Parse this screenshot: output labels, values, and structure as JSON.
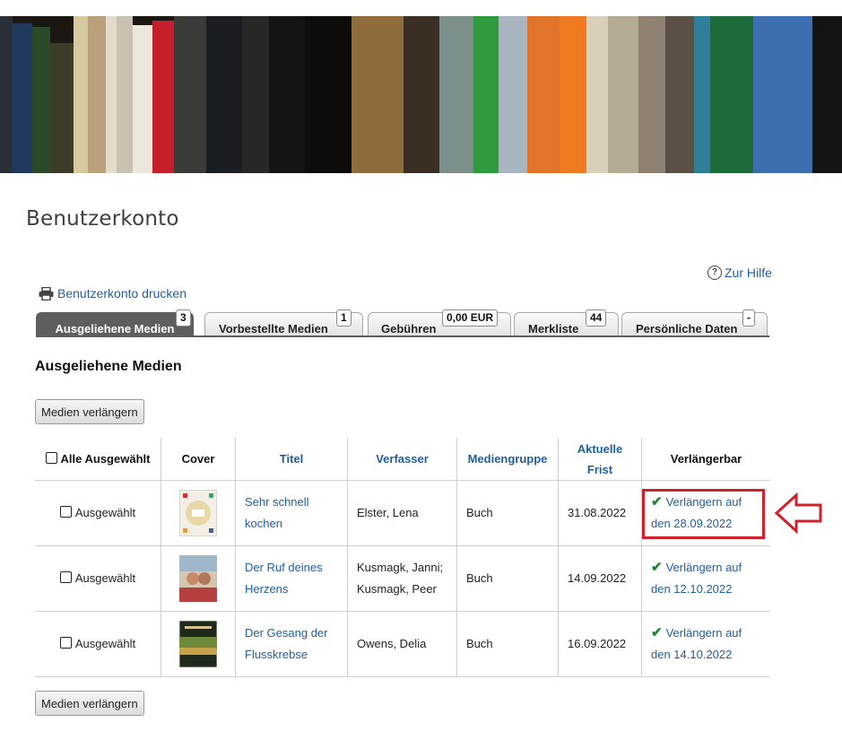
{
  "page": {
    "title": "Benutzerkonto"
  },
  "links": {
    "help": "Zur Hilfe",
    "print": "Benutzerkonto drucken"
  },
  "tabs": [
    {
      "label": "Ausgeliehene Medien",
      "badge": "3"
    },
    {
      "label": "Vorbestellte Medien",
      "badge": "1"
    },
    {
      "label": "Gebühren",
      "badge": "0,00 EUR"
    },
    {
      "label": "Merkliste",
      "badge": "44"
    },
    {
      "label": "Persönliche Daten",
      "badge": "-"
    }
  ],
  "section": {
    "title": "Ausgeliehene Medien",
    "renew_button": "Medien verlängern"
  },
  "table": {
    "headers": {
      "select_all": "Alle Ausgewählt",
      "cover": "Cover",
      "title": "Titel",
      "author": "Verfasser",
      "media_group": "Mediengruppe",
      "due_line1": "Aktuelle",
      "due_line2": "Frist",
      "renewable": "Verlängerbar"
    },
    "rows": [
      {
        "select": "Ausgewählt",
        "title_line1": "Sehr schnell",
        "title_line2": "kochen",
        "author_line1": "Elster, Lena",
        "author_line2": "",
        "media_group": "Buch",
        "due": "31.08.2022",
        "renew_line1": "Verlängern auf",
        "renew_line2": "den 28.09.2022"
      },
      {
        "select": "Ausgewählt",
        "title_line1": "Der Ruf deines",
        "title_line2": "Herzens",
        "author_line1": "Kusmagk, Janni;",
        "author_line2": "Kusmagk, Peer",
        "media_group": "Buch",
        "due": "14.09.2022",
        "renew_line1": "Verlängern auf",
        "renew_line2": "den 12.10.2022"
      },
      {
        "select": "Ausgewählt",
        "title_line1": "Der Gesang der",
        "title_line2": "Flusskrebse",
        "author_line1": "Owens, Delia",
        "author_line2": "",
        "media_group": "Buch",
        "due": "16.09.2022",
        "renew_line1": "Verlängern auf",
        "renew_line2": "den 14.10.2022"
      }
    ]
  },
  "colors": {
    "link": "#1f5e9e",
    "active_tab": "#5e5e5e",
    "check": "#1a8a2e",
    "highlight": "#d0202a"
  },
  "icons": {
    "print": "printer-icon",
    "help": "help-icon",
    "renewable": "checkmark-icon",
    "annotation": "arrow-left-icon"
  }
}
